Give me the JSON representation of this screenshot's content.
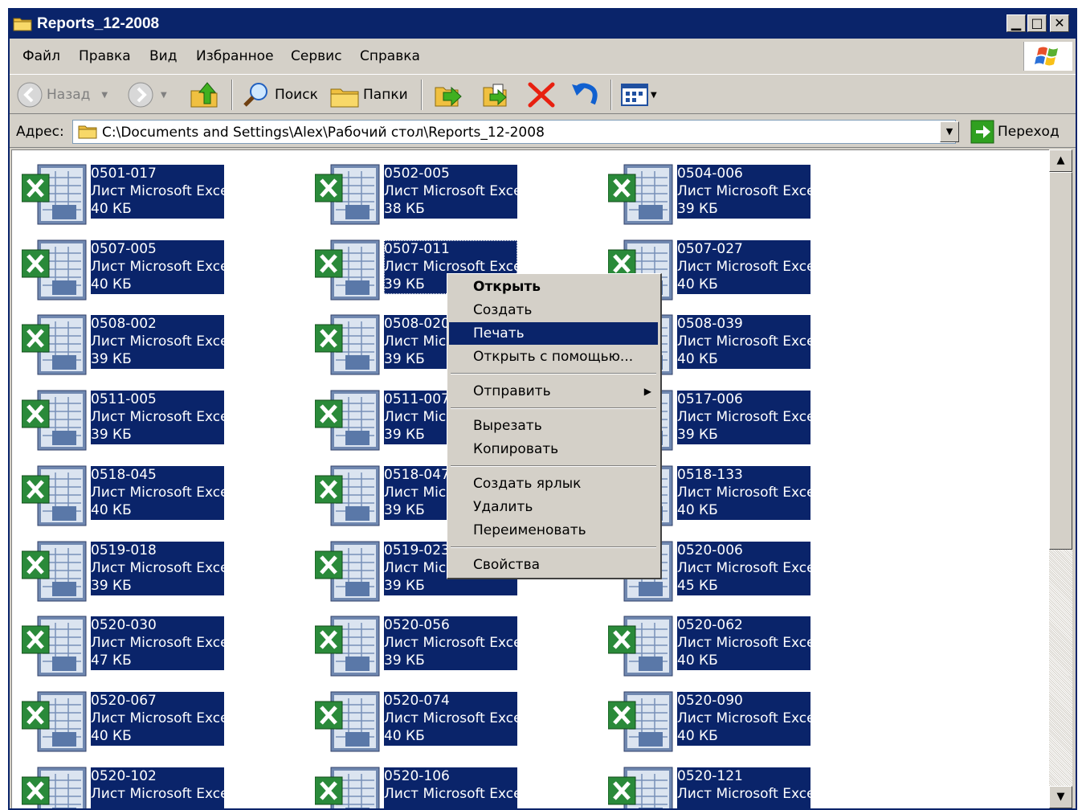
{
  "window": {
    "title": "Reports_12-2008",
    "minimize": "▁",
    "maximize": "□",
    "close": "✕"
  },
  "menu": [
    "Файл",
    "Правка",
    "Вид",
    "Избранное",
    "Сервис",
    "Справка"
  ],
  "toolbar": {
    "back": "Назад",
    "search": "Поиск",
    "folders": "Папки"
  },
  "address": {
    "label": "Адрес:",
    "path": "C:\\Documents and Settings\\Alex\\Рабочий стол\\Reports_12-2008",
    "go": "Переход"
  },
  "files": [
    {
      "name": "0501-017",
      "type": "Лист Microsoft Excel",
      "size": "40 КБ"
    },
    {
      "name": "0502-005",
      "type": "Лист Microsoft Excel",
      "size": "38 КБ"
    },
    {
      "name": "0504-006",
      "type": "Лист Microsoft Excel",
      "size": "39 КБ"
    },
    {
      "name": "0507-005",
      "type": "Лист Microsoft Excel",
      "size": "40 КБ"
    },
    {
      "name": "0507-011",
      "type": "Лист Microsoft Excel",
      "size": "39 КБ"
    },
    {
      "name": "0507-027",
      "type": "Лист Microsoft Excel",
      "size": "40 КБ"
    },
    {
      "name": "0508-002",
      "type": "Лист Microsoft Excel",
      "size": "39 КБ"
    },
    {
      "name": "0508-020",
      "type": "Лист Microsoft Excel",
      "size": "39 КБ"
    },
    {
      "name": "0508-039",
      "type": "Лист Microsoft Excel",
      "size": "40 КБ"
    },
    {
      "name": "0511-005",
      "type": "Лист Microsoft Excel",
      "size": "39 КБ"
    },
    {
      "name": "0511-007",
      "type": "Лист Microsoft Excel",
      "size": "39 КБ"
    },
    {
      "name": "0517-006",
      "type": "Лист Microsoft Excel",
      "size": "39 КБ"
    },
    {
      "name": "0518-045",
      "type": "Лист Microsoft Excel",
      "size": "40 КБ"
    },
    {
      "name": "0518-047",
      "type": "Лист Microsoft Excel",
      "size": "39 КБ"
    },
    {
      "name": "0518-133",
      "type": "Лист Microsoft Excel",
      "size": "40 КБ"
    },
    {
      "name": "0519-018",
      "type": "Лист Microsoft Excel",
      "size": "39 КБ"
    },
    {
      "name": "0519-023",
      "type": "Лист Microsoft Excel",
      "size": "39 КБ"
    },
    {
      "name": "0520-006",
      "type": "Лист Microsoft Excel",
      "size": "45 КБ"
    },
    {
      "name": "0520-030",
      "type": "Лист Microsoft Excel",
      "size": "47 КБ"
    },
    {
      "name": "0520-056",
      "type": "Лист Microsoft Excel",
      "size": "39 КБ"
    },
    {
      "name": "0520-062",
      "type": "Лист Microsoft Excel",
      "size": "40 КБ"
    },
    {
      "name": "0520-067",
      "type": "Лист Microsoft Excel",
      "size": "40 КБ"
    },
    {
      "name": "0520-074",
      "type": "Лист Microsoft Excel",
      "size": "40 КБ"
    },
    {
      "name": "0520-090",
      "type": "Лист Microsoft Excel",
      "size": "40 КБ"
    },
    {
      "name": "0520-102",
      "type": "Лист Microsoft Excel",
      "size": ""
    },
    {
      "name": "0520-106",
      "type": "Лист Microsoft Excel",
      "size": ""
    },
    {
      "name": "0520-121",
      "type": "Лист Microsoft Excel",
      "size": ""
    }
  ],
  "context_menu": {
    "open": "Открыть",
    "create": "Создать",
    "print": "Печать",
    "open_with": "Открыть с помощью...",
    "send_to": "Отправить",
    "cut": "Вырезать",
    "copy": "Копировать",
    "create_shortcut": "Создать ярлык",
    "delete": "Удалить",
    "rename": "Переименовать",
    "properties": "Свойства"
  },
  "colors": {
    "selection": "#0a246a",
    "face": "#d4d0c8"
  }
}
